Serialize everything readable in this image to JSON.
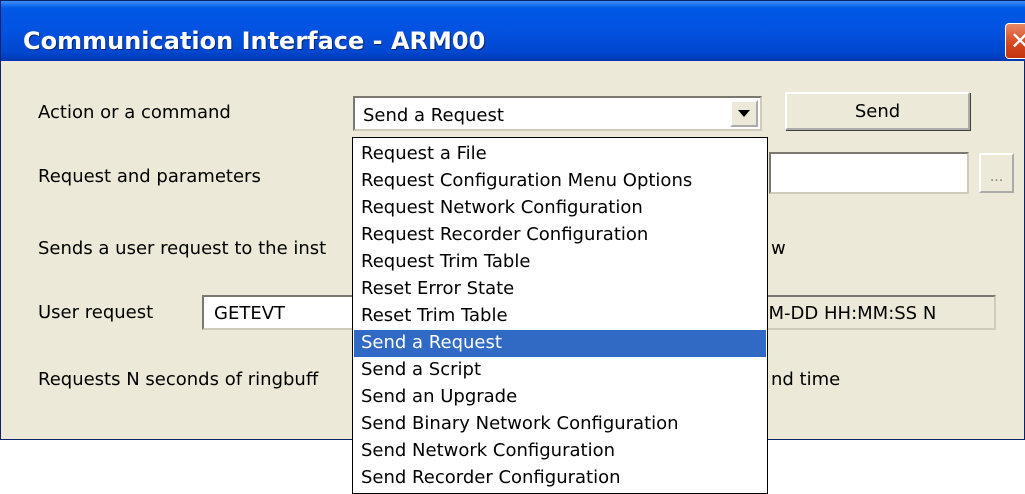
{
  "window": {
    "title": "Communication Interface - ARM00",
    "close_glyph": "✕"
  },
  "form": {
    "action_label": "Action or a command",
    "action_value": "Send a Request",
    "send_button": "Send",
    "request_label": "Request and parameters",
    "browse_button": "...",
    "description_left": "Sends a user request to the inst",
    "description_right": "w",
    "user_request_label": "User request",
    "user_request_value": "GETEVT",
    "format_hint": "MM-DD HH:MM:SS N",
    "request_desc_left": "Requests N seconds of ringbuff",
    "request_desc_right": "nd time"
  },
  "dropdown": {
    "items": [
      {
        "label": "Request a File"
      },
      {
        "label": "Request Configuration Menu Options"
      },
      {
        "label": "Request Network Configuration"
      },
      {
        "label": "Request Recorder Configuration"
      },
      {
        "label": "Request Trim Table"
      },
      {
        "label": "Reset Error State"
      },
      {
        "label": "Reset Trim Table"
      },
      {
        "label": "Send a Request"
      },
      {
        "label": "Send a Script"
      },
      {
        "label": "Send an Upgrade"
      },
      {
        "label": "Send Binary Network Configuration"
      },
      {
        "label": "Send Network Configuration"
      },
      {
        "label": "Send Recorder Configuration"
      }
    ],
    "selected": "Send a Request"
  },
  "colors": {
    "titlebar": "#0352e0",
    "window_bg": "#ece9d8",
    "selection": "#316ac5",
    "close_button": "#d44a20"
  },
  "icons": {
    "close": "close-icon",
    "dropdown_arrow": "chevron-down-icon"
  }
}
